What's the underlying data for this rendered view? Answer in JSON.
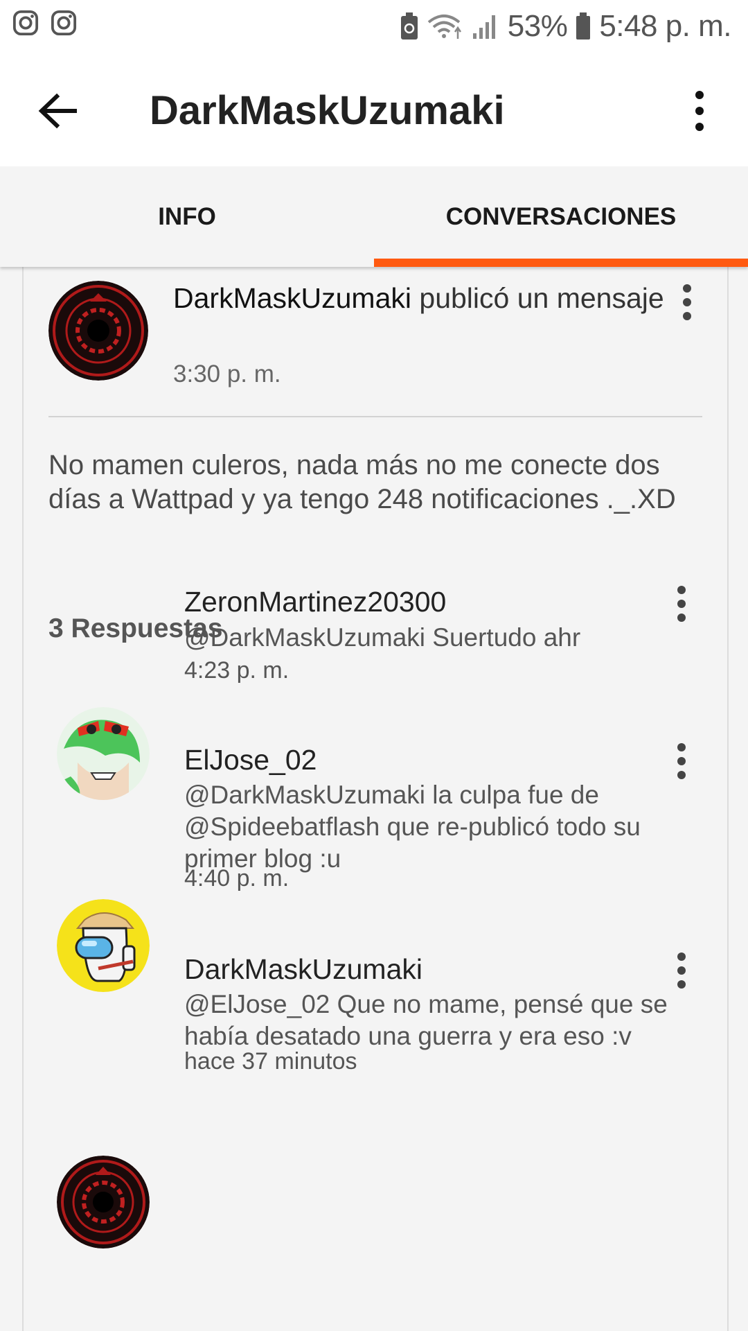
{
  "status_bar": {
    "left_icons": [
      "instagram-icon",
      "instagram-icon"
    ],
    "battery_percent": "53%",
    "time": "5:48 p. m."
  },
  "app_bar": {
    "title": "DarkMaskUzumaki"
  },
  "tabs": [
    {
      "label": "INFO",
      "active": false
    },
    {
      "label": "CONVERSACIONES",
      "active": true
    }
  ],
  "accent_color": "#ff5a10",
  "post": {
    "author": "DarkMaskUzumaki",
    "action": " publicó un mensaje",
    "time": "3:30 p. m.",
    "body": "No mamen culeros, nada más no me conecte dos días a Wattpad y ya tengo 248 notificaciones ._.XD"
  },
  "replies_title": "3 Respuestas",
  "replies": [
    {
      "name": "ZeronMartinez20300",
      "text": "@DarkMaskUzumaki Suertudo ahr",
      "time": "4:23 p. m."
    },
    {
      "name": "ElJose_02",
      "text": "@DarkMaskUzumaki la culpa fue de @Spideebatflash que re-publicó todo su primer blog :u",
      "time": "4:40 p. m."
    },
    {
      "name": "DarkMaskUzumaki",
      "text": "@ElJose_02 Que no mame, pensé que se había desatado una guerra y era eso :v",
      "time": "hace 37 minutos"
    }
  ]
}
